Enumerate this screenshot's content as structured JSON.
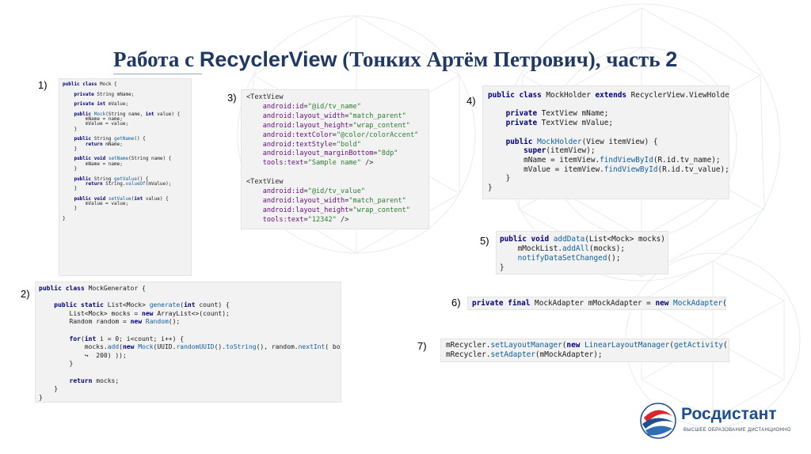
{
  "title": {
    "prefix": "Работа с ",
    "class_name": "RecyclerView",
    "suffix": " (Тонких Артём Петрович), часть ",
    "part": "2"
  },
  "labels": [
    "1)",
    "2)",
    "3)",
    "4)",
    "5)",
    "6)",
    "7)"
  ],
  "code_blocks": [
    {
      "id": "1",
      "lines": [
        "public class Mock {",
        "",
        "    private String mName;",
        "",
        "    private int mValue;",
        "",
        "    public Mock(String name, int value) {",
        "        mName = name;",
        "        mValue = value;",
        "    }",
        "",
        "    public String getName() {",
        "        return mName;",
        "    }",
        "",
        "    public void setName(String name) {",
        "        mName = name;",
        "    }",
        "",
        "    public String getValue() {",
        "        return String.valueOf(mValue);",
        "    }",
        "",
        "    public void setValue(int value) {",
        "        mValue = value;",
        "    }",
        "",
        "}"
      ]
    },
    {
      "id": "2",
      "lines": [
        "public class MockGenerator {",
        "",
        "    public static List<Mock> generate(int count) {",
        "        List<Mock> mocks = new ArrayList<>(count);",
        "        Random random = new Random();",
        "",
        "        for(int i = 0; i<count; i++) {",
        "            mocks.add(new Mock(UUID.randomUUID().toString(), random.nextInt( bound:",
        "            ↪  200) ));",
        "        }",
        "",
        "        return mocks;",
        "    }",
        "}"
      ]
    },
    {
      "id": "3",
      "lines": [
        "<TextView",
        "    android:id=\"@id/tv_name\"",
        "    android:layout_width=\"match_parent\"",
        "    android:layout_height=\"wrap_content\"",
        "    android:textColor=\"@color/colorAccent\"",
        "    android:textStyle=\"bold\"",
        "    android:layout_marginBottom=\"8dp\"",
        "    tools:text=\"Sample name\" />",
        "",
        "<TextView",
        "    android:id=\"@id/tv_value\"",
        "    android:layout_width=\"match_parent\"",
        "    android:layout_height=\"wrap_content\"",
        "    tools:text=\"12342\" />"
      ]
    },
    {
      "id": "4",
      "lines": [
        "public class MockHolder extends RecyclerView.ViewHolder {",
        "",
        "    private TextView mName;",
        "    private TextView mValue;",
        "",
        "    public MockHolder(View itemView) {",
        "        super(itemView);",
        "        mName = itemView.findViewById(R.id.tv_name);",
        "        mValue = itemView.findViewById(R.id.tv_value);",
        "    }",
        "}"
      ]
    },
    {
      "id": "5",
      "lines": [
        "public void addData(List<Mock> mocks) {",
        "    mMockList.addAll(mocks);",
        "    notifyDataSetChanged();",
        "}"
      ]
    },
    {
      "id": "6",
      "lines": [
        "private final MockAdapter mMockAdapter = new MockAdapter();"
      ]
    },
    {
      "id": "7",
      "lines": [
        "mRecycler.setLayoutManager(new LinearLayoutManager(getActivity()));",
        "mRecycler.setAdapter(mMockAdapter);"
      ]
    }
  ],
  "logo": {
    "name": "Росдистант",
    "subtitle": "ВЫСШЕЕ ОБРАЗОВАНИЕ ДИСТАНЦИОННО"
  },
  "colors": {
    "title": "#1f3864",
    "keyword": "#000080",
    "method": "#1060a0",
    "string": "#2e7d32",
    "attribute": "#660e7a",
    "code_background": "#f2f2f2",
    "logo_red": "#d8252e",
    "logo_blue": "#1f4e8c"
  }
}
